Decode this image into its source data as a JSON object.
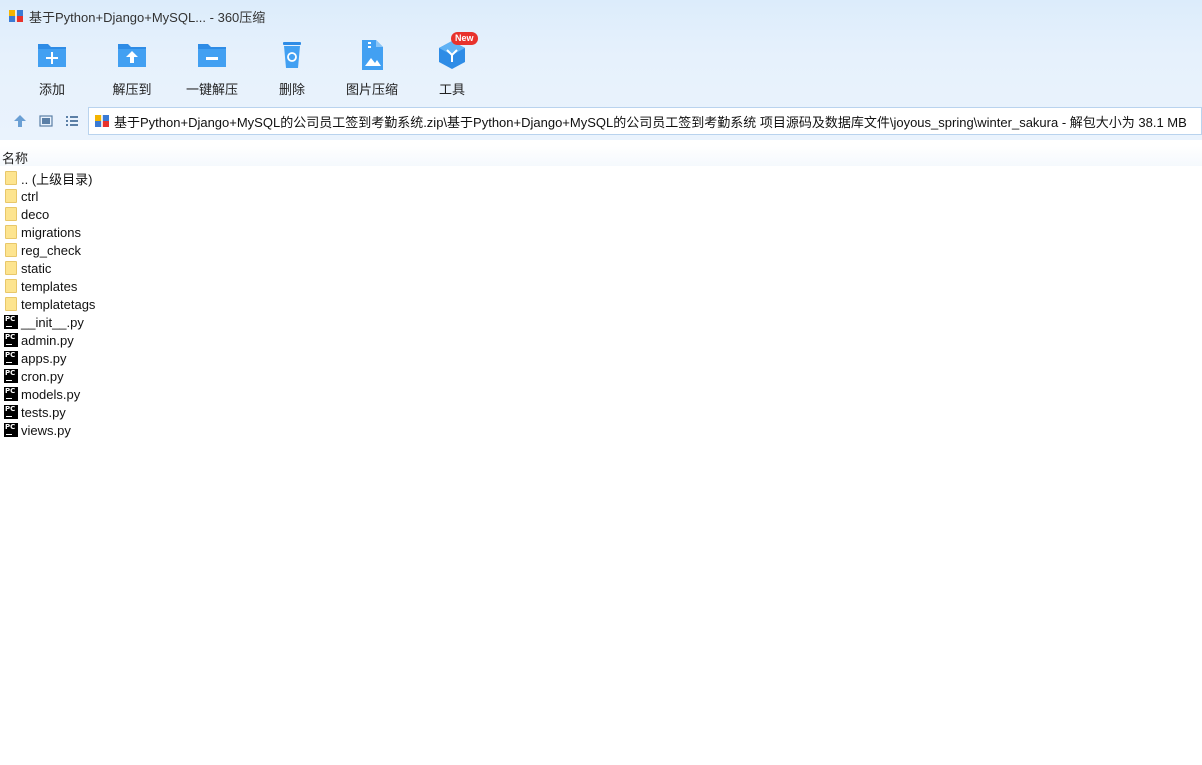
{
  "window": {
    "title": "基于Python+Django+MySQL... - 360压缩"
  },
  "toolbar": {
    "items": [
      {
        "label": "添加",
        "icon": "add-folder-icon"
      },
      {
        "label": "解压到",
        "icon": "extract-to-icon"
      },
      {
        "label": "一键解压",
        "icon": "one-click-extract-icon"
      },
      {
        "label": "删除",
        "icon": "recycle-bin-icon"
      },
      {
        "label": "图片压缩",
        "icon": "image-compress-icon"
      },
      {
        "label": "工具",
        "icon": "tools-cube-icon",
        "badge": "New"
      }
    ]
  },
  "address": {
    "path": "基于Python+Django+MySQL的公司员工签到考勤系统.zip\\基于Python+Django+MySQL的公司员工签到考勤系统 项目源码及数据库文件\\joyous_spring\\winter_sakura - 解包大小为 38.1 MB"
  },
  "columns": {
    "name": "名称"
  },
  "files": [
    {
      "name": ".. (上级目录)",
      "type": "folder"
    },
    {
      "name": "ctrl",
      "type": "folder"
    },
    {
      "name": "deco",
      "type": "folder"
    },
    {
      "name": "migrations",
      "type": "folder"
    },
    {
      "name": "reg_check",
      "type": "folder"
    },
    {
      "name": "static",
      "type": "folder"
    },
    {
      "name": "templates",
      "type": "folder"
    },
    {
      "name": "templatetags",
      "type": "folder"
    },
    {
      "name": "__init__.py",
      "type": "py"
    },
    {
      "name": "admin.py",
      "type": "py"
    },
    {
      "name": "apps.py",
      "type": "py"
    },
    {
      "name": "cron.py",
      "type": "py"
    },
    {
      "name": "models.py",
      "type": "py"
    },
    {
      "name": "tests.py",
      "type": "py"
    },
    {
      "name": "views.py",
      "type": "py"
    }
  ],
  "colors": {
    "accent": "#1e88e5",
    "folder": "#fde48f",
    "badge": "#e8322c"
  }
}
